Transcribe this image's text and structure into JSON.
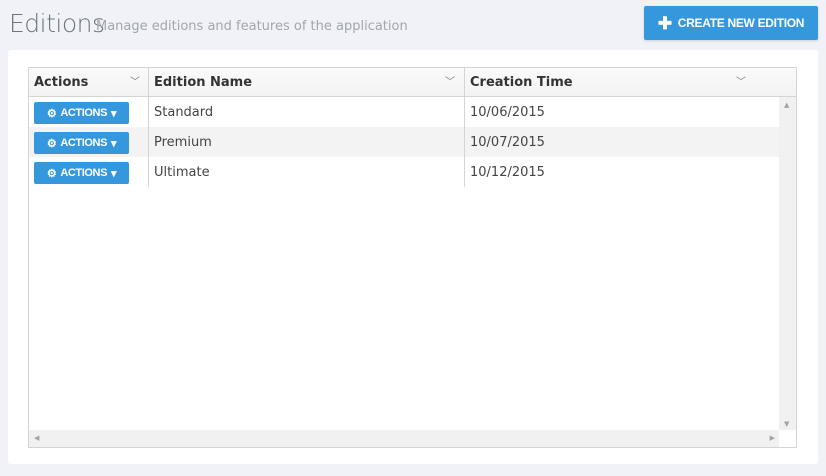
{
  "header": {
    "title": "Editions",
    "subtitle": "Manage editions and features of the application",
    "create_label": "CREATE NEW EDITION"
  },
  "grid": {
    "columns": [
      "Actions",
      "Edition Name",
      "Creation Time"
    ],
    "rows": [
      {
        "action_label": "ACTIONS",
        "name": "Standard",
        "created": "10/06/2015"
      },
      {
        "action_label": "ACTIONS",
        "name": "Premium",
        "created": "10/07/2015"
      },
      {
        "action_label": "ACTIONS",
        "name": "Ultimate",
        "created": "10/12/2015"
      }
    ]
  }
}
